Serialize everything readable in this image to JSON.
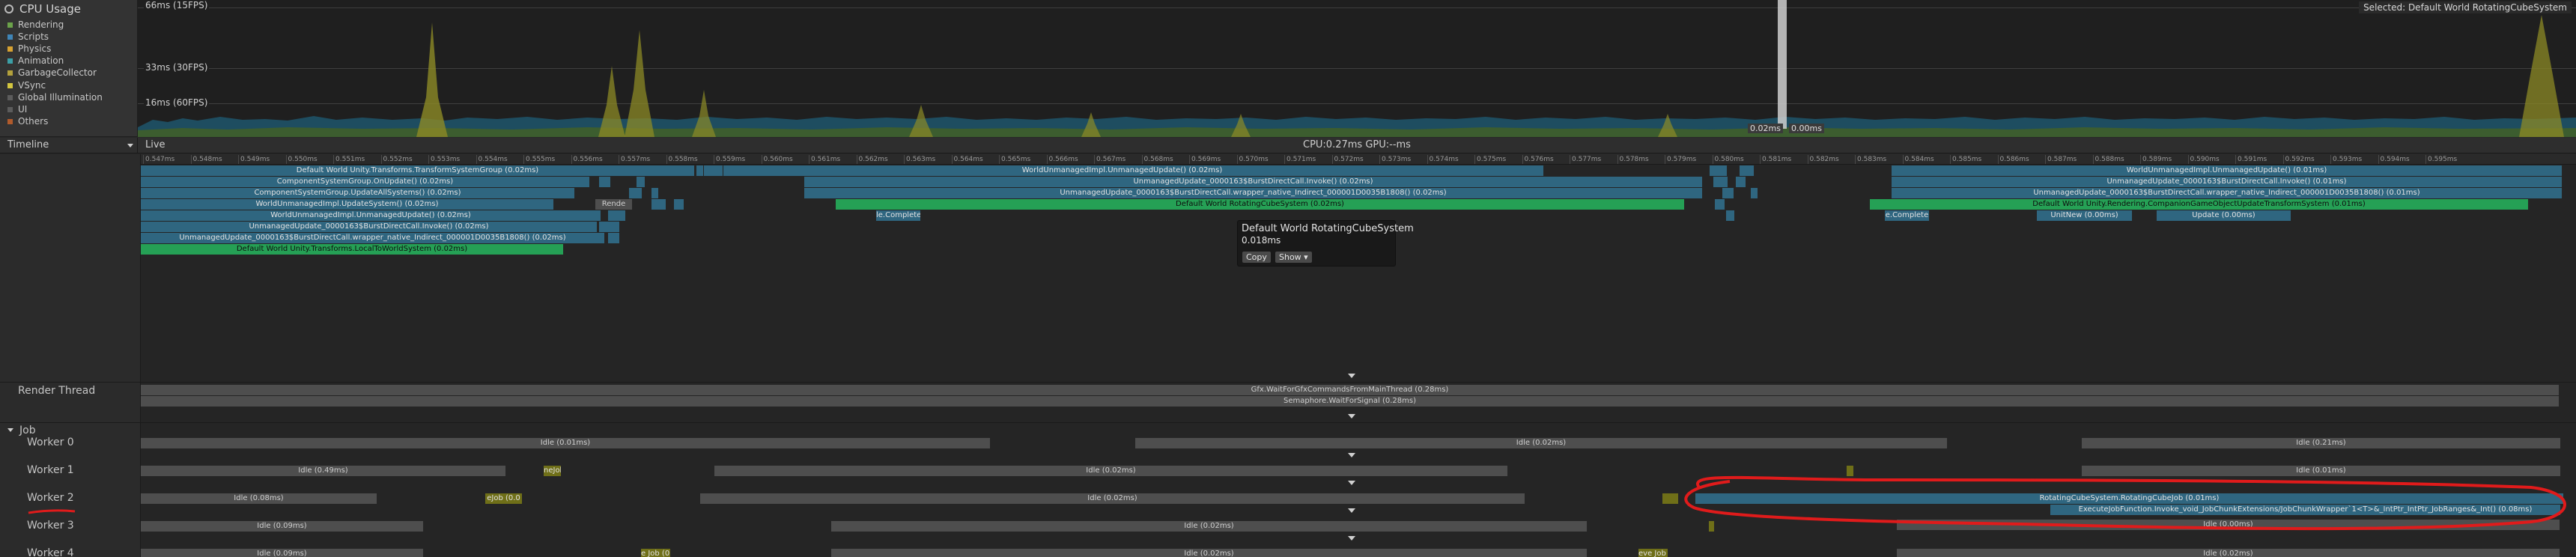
{
  "module": {
    "title": "CPU Usage"
  },
  "legend": [
    {
      "label": "Rendering",
      "color": "#6ba24a"
    },
    {
      "label": "Scripts",
      "color": "#3f85b7"
    },
    {
      "label": "Physics",
      "color": "#d7a232"
    },
    {
      "label": "Animation",
      "color": "#3c9fa6"
    },
    {
      "label": "GarbageCollector",
      "color": "#b3a13c"
    },
    {
      "label": "VSync",
      "color": "#d3c640"
    },
    {
      "label": "Global Illumination",
      "color": "#5c5c5c"
    },
    {
      "label": "UI",
      "color": "#5c5c5c"
    },
    {
      "label": "Others",
      "color": "#b05b2c"
    }
  ],
  "chart": {
    "scale_labels": [
      "66ms (15FPS)",
      "33ms (30FPS)",
      "16ms (60FPS)"
    ],
    "selected_label": "Selected: Default World RotatingCubeSystem",
    "readout": [
      "0.02ms",
      "0.00ms"
    ]
  },
  "timeline": {
    "view_mode": "Timeline",
    "live_label": "Live",
    "cpu_gpu": "CPU:0.27ms   GPU:--ms",
    "ticks": [
      "0.547ms",
      "0.548ms",
      "0.549ms",
      "0.550ms",
      "0.551ms",
      "0.552ms",
      "0.553ms",
      "0.554ms",
      "0.555ms",
      "0.556ms",
      "0.557ms",
      "0.558ms",
      "0.559ms",
      "0.560ms",
      "0.561ms",
      "0.562ms",
      "0.563ms",
      "0.564ms",
      "0.565ms",
      "0.566ms",
      "0.567ms",
      "0.568ms",
      "0.569ms",
      "0.570ms",
      "0.571ms",
      "0.572ms",
      "0.573ms",
      "0.574ms",
      "0.575ms",
      "0.576ms",
      "0.577ms",
      "0.578ms",
      "0.579ms",
      "0.580ms",
      "0.581ms",
      "0.582ms",
      "0.583ms",
      "0.584ms",
      "0.585ms",
      "0.586ms",
      "0.587ms",
      "0.588ms",
      "0.589ms",
      "0.590ms",
      "0.591ms",
      "0.592ms",
      "0.593ms",
      "0.594ms",
      "0.595ms"
    ],
    "main": {
      "row1": [
        "Default World Unity.Transforms.TransformSystemGroup (0.02ms)",
        "WorldUnmanagedImpl.UnmanagedUpdate() (0.02ms)",
        "WorldUnmanagedImpl.UnmanagedUpdate() (0.01ms)"
      ],
      "row2": [
        "ComponentSystemGroup.OnUpdate() (0.02ms)",
        "UnmanagedUpdate_0000163$BurstDirectCall.Invoke() (0.02ms)",
        "UnmanagedUpdate_0000163$BurstDirectCall.Invoke() (0.01ms)"
      ],
      "row3": [
        "ComponentSystemGroup.UpdateAllSystems() (0.02ms)",
        "UnmanagedUpdate_0000163$BurstDirectCall.wrapper_native_Indirect_000001D0035B1808() (0.02ms)",
        "UnmanagedUpdate_0000163$BurstDirectCall.wrapper_native_Indirect_000001D0035B1808() (0.01ms)"
      ],
      "row4": [
        "WorldUnmanagedImpl.UpdateSystem() (0.02ms)",
        "Rende",
        "Default World RotatingCubeSystem (0.02ms)",
        "Default World Unity.Rendering.CompanionGameObjectUpdateTransformSystem (0.01ms)"
      ],
      "row5": [
        "WorldUnmanagedImpl.UnmanagedUpdate() (0.02ms)",
        "le.Complete",
        "e.Complete",
        "UnitNew (0.00ms)",
        "Update (0.00ms)"
      ],
      "row6": [
        "UnmanagedUpdate_0000163$BurstDirectCall.Invoke() (0.02ms)"
      ],
      "row7": [
        "UnmanagedUpdate_0000163$BurstDirectCall.wrapper_native_Indirect_000001D0035B1808() (0.02ms)"
      ],
      "row8": [
        "Default World Unity.Transforms.LocalToWorldSystem (0.02ms)"
      ]
    },
    "tooltip": {
      "title": "Default World RotatingCubeSystem",
      "time": "0.018ms",
      "copy_label": "Copy",
      "show_label": "Show ▾"
    },
    "render_thread": {
      "label": "Render Thread",
      "bars": [
        "Gfx.WaitForGfxCommandsFromMainThread (0.28ms)",
        "Semaphore.WaitForSignal (0.28ms)"
      ]
    },
    "job_group": {
      "label": "Job"
    },
    "workers": [
      {
        "label": "Worker 0",
        "bars": [
          "Idle (0.01ms)",
          "Idle (0.02ms)",
          "Idle (0.21ms)"
        ]
      },
      {
        "label": "Worker 1",
        "bars": [
          "Idle (0.49ms)",
          "neJob (0.",
          "Idle (0.02ms)",
          "Idle (0.01ms)"
        ]
      },
      {
        "label": "Worker 2",
        "bars": [
          "Idle (0.08ms)",
          "eJob (0.0",
          "Idle (0.02ms)",
          "RotatingCubeSystem.RotatingCubeJob (0.01ms)",
          "ExecuteJobFunction.Invoke_void_JobChunkExtensions/JobChunkWrapper`1<T>&_IntPtr_IntPtr_JobRanges&_Int() (0.08ms)"
        ]
      },
      {
        "label": "Worker 3",
        "bars": [
          "Idle (0.09ms)",
          "Idle (0.02ms)",
          "Idle (0.00ms)"
        ]
      },
      {
        "label": "Worker 4",
        "bars": [
          "Idle (0.09ms)",
          "e Job (0.0",
          "Idle (0.02ms)",
          "eve Job (0.0",
          "Idle (0.02ms)"
        ]
      }
    ]
  }
}
